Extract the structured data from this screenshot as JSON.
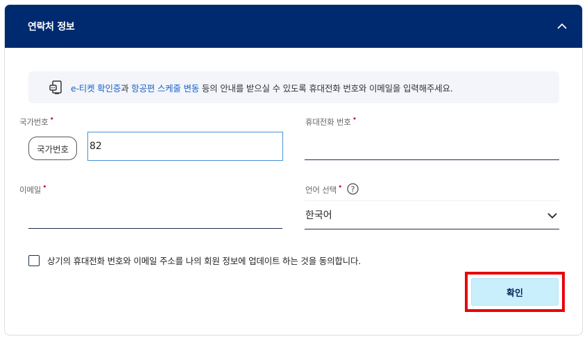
{
  "header": {
    "title": "연락처 정보"
  },
  "notice": {
    "link1": "e-티켓 확인증",
    "between": "과 ",
    "link2": "항공편 스케줄 변동",
    "rest": " 등의 안내를 받으실 수 있도록 휴대전화 번호와 이메일을 입력해주세요."
  },
  "form": {
    "country_label": "국가번호",
    "country_button": "국가번호",
    "country_value": "82",
    "phone_label": "휴대전화 번호",
    "phone_value": "",
    "email_label": "이메일",
    "email_value": "",
    "lang_label": "언어 선택",
    "lang_value": "한국어",
    "required_mark": "•"
  },
  "agree": {
    "label": "상기의 휴대전화 번호와 이메일 주소를 나의 회원 정보에 업데이트 하는 것을 동의합니다."
  },
  "confirm": {
    "label": "확인"
  },
  "colors": {
    "header_bg": "#002a6f",
    "link": "#1a64c8",
    "required": "#c8102e",
    "confirm_bg": "#c9effc",
    "highlight": "#e8000b"
  }
}
